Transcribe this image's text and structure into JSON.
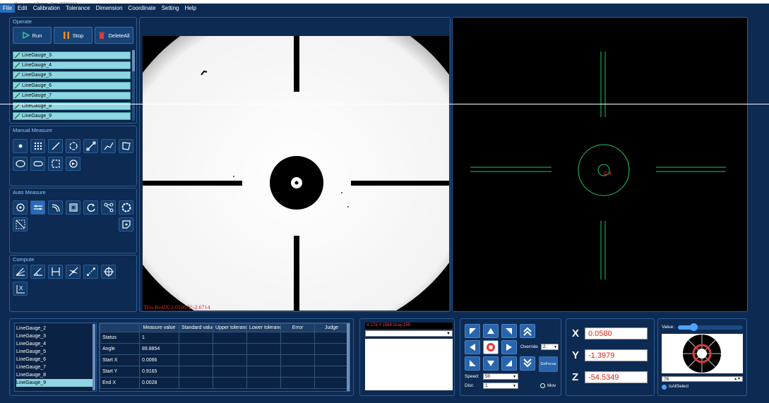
{
  "titlebar": {
    "text": "Measurement Project - Data 2023/10/13 ... "
  },
  "menu": [
    "File",
    "Edit",
    "Calibration",
    "Tolerance",
    "Dimension",
    "Coordinate",
    "Setting",
    "Help"
  ],
  "operate": {
    "title": "Operate",
    "run": "Run",
    "stop": "Stop",
    "delete_all": "DeleteAll",
    "items": [
      "LineGauge_3",
      "LineGauge_4",
      "LineGauge_5",
      "LineGauge_6",
      "LineGauge_7",
      "LineGauge_8",
      "LineGauge_9"
    ]
  },
  "manual_measure": {
    "title": "Manual Measure"
  },
  "auto_measure": {
    "title": "Auto Measure"
  },
  "compute": {
    "title": "Compute"
  },
  "camera": {
    "overlay": "This RealX:2.0106  Y:-2.6714"
  },
  "graphic": {
    "label": "C 4"
  },
  "result_list": [
    "LineGauge_2",
    "LineGauge_3",
    "LineGauge_4",
    "LineGauge_5",
    "LineGauge_6",
    "LineGauge_7",
    "LineGauge_8",
    "LineGauge_9"
  ],
  "table": {
    "headers": [
      "",
      "Measure value",
      "Standard value",
      "Upper tolerance",
      "Lower tolerance",
      "Error",
      "Judge"
    ],
    "rows": [
      [
        "Status",
        "1"
      ],
      [
        "Angle",
        "89.8854"
      ],
      [
        "Start X",
        "0.0066"
      ],
      [
        "Start Y",
        "0.9165"
      ],
      [
        "End X",
        "0.0028"
      ]
    ]
  },
  "pixel_info": "X:276  Y:1568  Gray:255",
  "motion": {
    "override_label": "Override",
    "override_value": "2",
    "gofocus": "GoFocus",
    "speed_label": "Speed:",
    "speed_value": "50",
    "dist_label": "Dist:",
    "dist_value": "1",
    "mov_label": "Mov"
  },
  "coords": {
    "x_label": "X",
    "x": "0.0580",
    "y_label": "Y",
    "y": "-1.3979",
    "z_label": "Z",
    "z": "-54.5349"
  },
  "light": {
    "value_label": "Value:",
    "value": "76",
    "value_fraction": 0.24,
    "all_select": "IsAllSelect"
  },
  "colors": {
    "bg": "#0d2a52",
    "panel_border": "#2d5d94",
    "list_item": "#8ed6e1",
    "accent": "#2b6cb8",
    "green": "#22c55e",
    "red": "#d9281c"
  }
}
